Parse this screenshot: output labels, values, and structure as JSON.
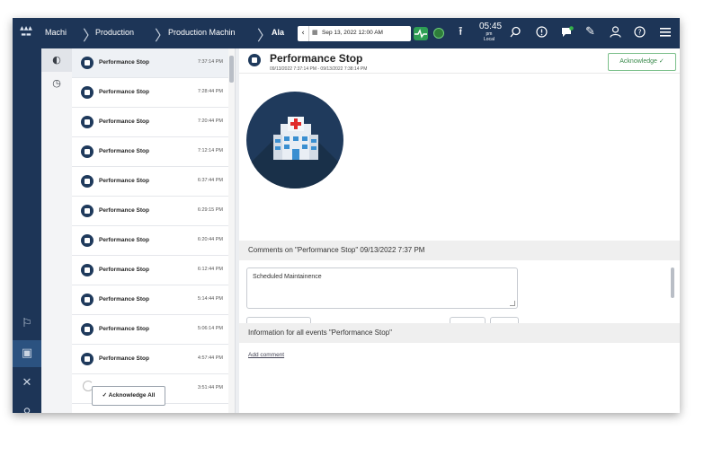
{
  "header": {
    "breadcrumbs": [
      "Machi",
      "Production",
      "Production Machin",
      "Ala"
    ],
    "date_range": "Sep 13, 2022 12:00 AM",
    "clock": {
      "time": "05:45",
      "ampm": "pm",
      "zone": "Local"
    }
  },
  "colors": {
    "nav": "#1d3557",
    "accent_green": "#3a8a4c",
    "icon_dark": "#1f3a5c"
  },
  "events": [
    {
      "name": "Performance Stop",
      "time": "7:37:14 PM"
    },
    {
      "name": "Performance Stop",
      "time": "7:28:44 PM"
    },
    {
      "name": "Performance Stop",
      "time": "7:20:44 PM"
    },
    {
      "name": "Performance Stop",
      "time": "7:12:14 PM"
    },
    {
      "name": "Performance Stop",
      "time": "6:37:44 PM"
    },
    {
      "name": "Performance Stop",
      "time": "6:29:15 PM"
    },
    {
      "name": "Performance Stop",
      "time": "6:20:44 PM"
    },
    {
      "name": "Performance Stop",
      "time": "6:12:44 PM"
    },
    {
      "name": "Performance Stop",
      "time": "5:14:44 PM"
    },
    {
      "name": "Performance Stop",
      "time": "5:06:14 PM"
    },
    {
      "name": "Performance Stop",
      "time": "4:57:44 PM"
    },
    {
      "name": "",
      "time": "3:51:44 PM"
    }
  ],
  "list": {
    "acknowledge_all": "✓ Acknowledge All"
  },
  "detail": {
    "title": "Performance Stop",
    "subtitle": "09/13/2022 7:37:14 PM - 09/13/2022 7:38:14 PM",
    "acknowledge": "Acknowledge ✓",
    "comments_header": "Comments on \"Performance Stop\" 09/13/2022 7:37 PM",
    "comment_value": "Scheduled Maintainence",
    "info_header": "Information for all events \"Performance Stop\"",
    "add_comment": "Add comment"
  }
}
